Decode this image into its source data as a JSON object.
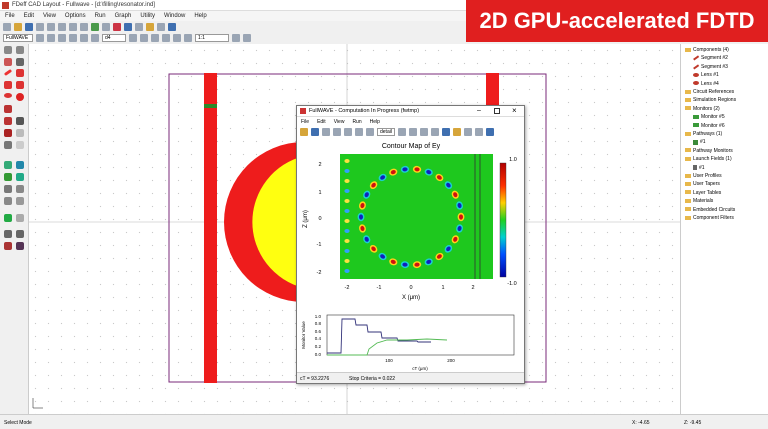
{
  "window": {
    "title": "FDeff CAD Layout - Fullwave - [d:\\filling\\resonator.ind]"
  },
  "banner": {
    "text": "2D GPU-accelerated FDTD"
  },
  "menu": [
    "File",
    "Edit",
    "View",
    "Options",
    "Run",
    "Graph",
    "Utility",
    "Window",
    "Help"
  ],
  "toolbar": {
    "layer_select": "FullWAVE",
    "zoom_value": "1:1",
    "edit_value": "d4"
  },
  "tree": [
    {
      "label": "Components (4)",
      "icon": "folder",
      "indent": 0
    },
    {
      "label": "Segment #2",
      "icon": "seg",
      "indent": 1
    },
    {
      "label": "Segment #3",
      "icon": "seg",
      "indent": 1
    },
    {
      "label": "Lens #1",
      "icon": "lens",
      "indent": 1
    },
    {
      "label": "Lens #4",
      "icon": "lens",
      "indent": 1
    },
    {
      "label": "Circuit References",
      "icon": "folder",
      "indent": 0
    },
    {
      "label": "Simulation Regions",
      "icon": "folder",
      "indent": 0
    },
    {
      "label": "Monitors (2)",
      "icon": "folder",
      "indent": 0
    },
    {
      "label": "Monitor #5",
      "icon": "mon",
      "indent": 1
    },
    {
      "label": "Monitor #6",
      "icon": "mon",
      "indent": 1
    },
    {
      "label": "Pathways (1)",
      "icon": "folder",
      "indent": 0
    },
    {
      "label": "#1",
      "icon": "path",
      "indent": 1
    },
    {
      "label": "Pathway Monitors",
      "icon": "folder",
      "indent": 0
    },
    {
      "label": "Launch Fields (1)",
      "icon": "folder",
      "indent": 0
    },
    {
      "label": "#1",
      "icon": "launch",
      "indent": 1
    },
    {
      "label": "User Profiles",
      "icon": "folder",
      "indent": 0
    },
    {
      "label": "User Tapers",
      "icon": "folder",
      "indent": 0
    },
    {
      "label": "Layer Tables",
      "icon": "folder",
      "indent": 0
    },
    {
      "label": "Materials",
      "icon": "folder",
      "indent": 0
    },
    {
      "label": "Embedded Circuits",
      "icon": "folder",
      "indent": 0
    },
    {
      "label": "Component Filters",
      "icon": "folder",
      "indent": 0
    }
  ],
  "status": {
    "mode": "Select Mode",
    "x": "X: -4.65",
    "z": "Z: -9.45"
  },
  "dialog": {
    "title": "FullWAVE - Computation In Progress (fwtmp)",
    "menu": [
      "File",
      "Edit",
      "View",
      "Run",
      "Help"
    ],
    "tool_combo": "detail",
    "contour": {
      "title": "Contour Map of Ey",
      "xlabel": "X (μm)",
      "ylabel": "Z (μm)",
      "xticks": [
        "-2",
        "-1",
        "0",
        "1",
        "2"
      ],
      "yticks": [
        "2",
        "1",
        "0",
        "-1",
        "-2"
      ],
      "colorbar_max": "1.0",
      "colorbar_min": "-1.0"
    },
    "monitor": {
      "ylabel": "Monitor Value",
      "xlabel": "cT (μm)",
      "yticks": [
        "1.0",
        "0.8",
        "0.6",
        "0.4",
        "0.2",
        "0.0"
      ],
      "xticks": [
        "100",
        "200"
      ]
    },
    "status_ct": "cT = 93.2276",
    "status_stop": "Stop Criteria = 0.022"
  },
  "colors": {
    "banner": "#e01f1f",
    "waveguide": "#ee1c1c",
    "lens_fill": "#ffff10",
    "field_bg": "#1ec81e",
    "monitor_dark": "#33337a",
    "monitor_green": "#55bb55"
  }
}
